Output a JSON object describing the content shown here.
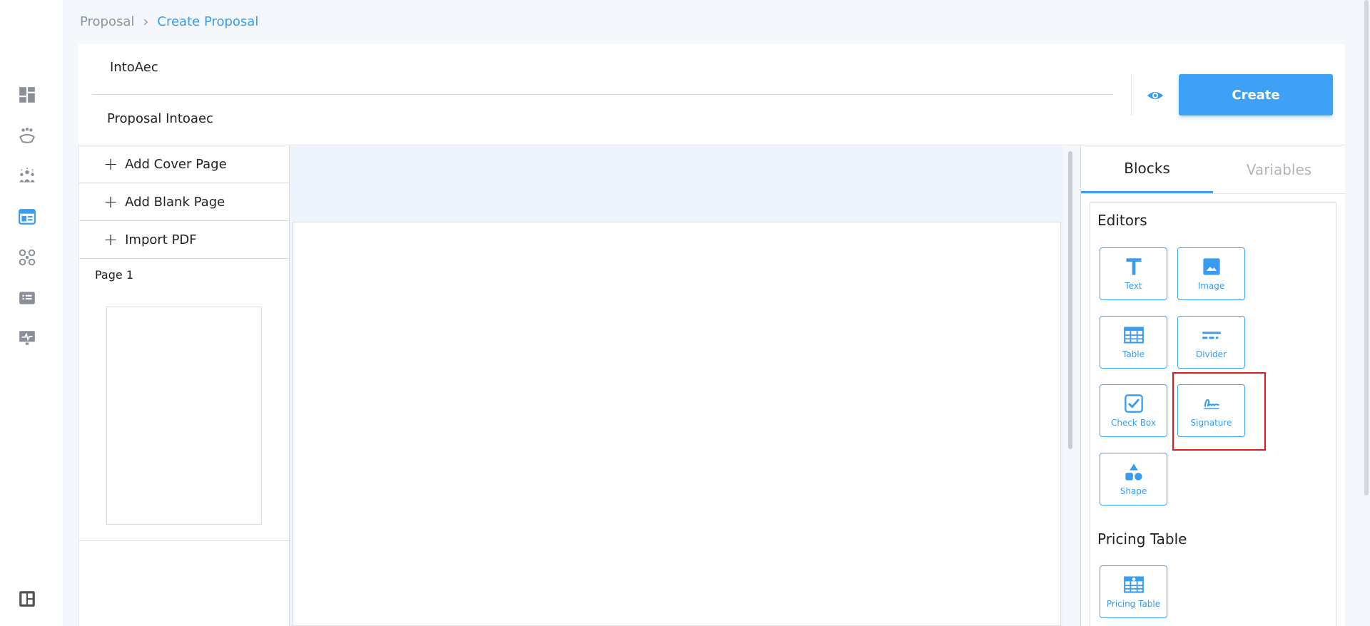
{
  "breadcrumb": {
    "root": "Proposal",
    "separator": "›",
    "current": "Create Proposal"
  },
  "header": {
    "company": "IntoAec",
    "proposal_title": "Proposal Intoaec",
    "create_label": "Create"
  },
  "left_panel": {
    "add_items": [
      {
        "label": "Add Cover Page"
      },
      {
        "label": "Add Blank Page"
      },
      {
        "label": "Import PDF"
      }
    ],
    "page_label": "Page 1"
  },
  "right_panel": {
    "tabs": [
      {
        "label": "Blocks"
      },
      {
        "label": "Variables"
      }
    ],
    "editors_title": "Editors",
    "editors": [
      {
        "label": "Text",
        "icon": "text-icon"
      },
      {
        "label": "Image",
        "icon": "image-icon"
      },
      {
        "label": "Table",
        "icon": "table-icon"
      },
      {
        "label": "Divider",
        "icon": "divider-icon"
      },
      {
        "label": "Check Box",
        "icon": "checkbox-icon"
      },
      {
        "label": "Signature",
        "icon": "signature-icon"
      },
      {
        "label": "Shape",
        "icon": "shape-icon"
      }
    ],
    "pricing_title": "Pricing Table",
    "pricing": [
      {
        "label": "Pricing Table",
        "icon": "pricing-table-icon"
      }
    ]
  },
  "sidebar": {
    "icons": [
      "dashboard-icon",
      "handshake-icon",
      "team-icon",
      "proposal-icon",
      "network-icon",
      "list-icon",
      "monitor-icon",
      "layout-icon"
    ]
  },
  "colors": {
    "accent": "#3ea1f6",
    "highlight": "#e11b1b",
    "sidebar_icon": "#8a8f97",
    "active_icon": "#3a9cf0"
  }
}
